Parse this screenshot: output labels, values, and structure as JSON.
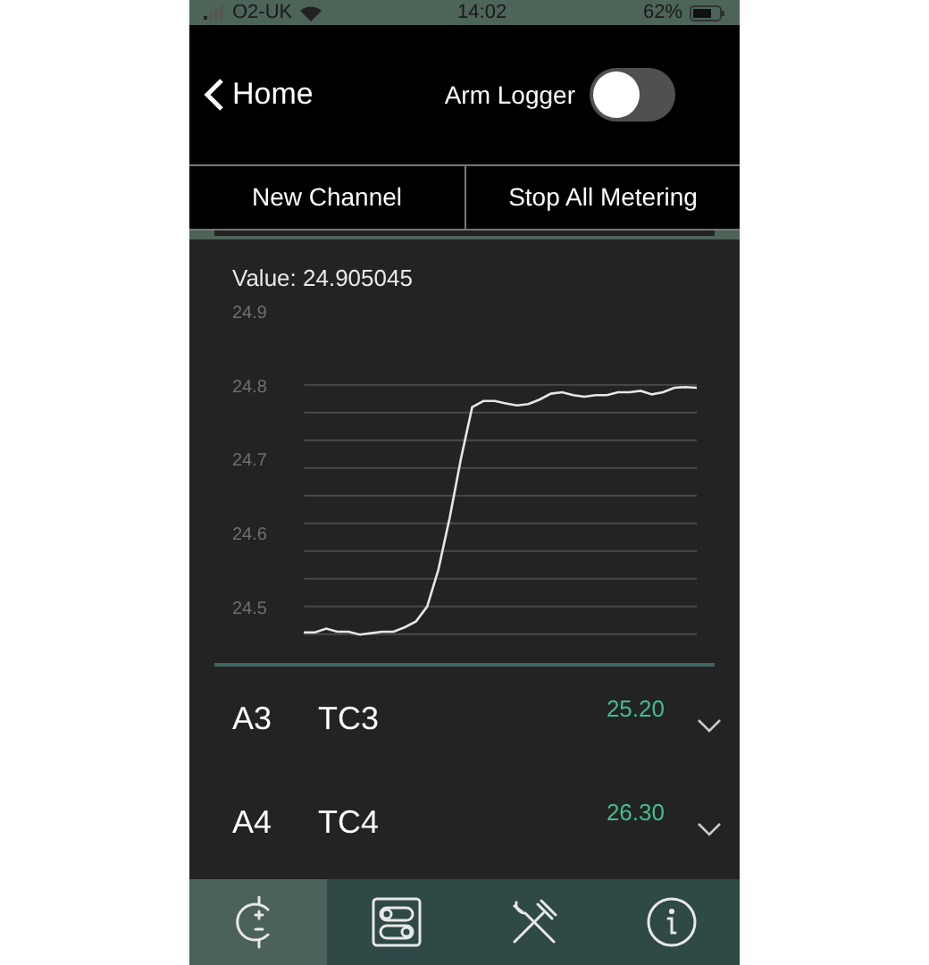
{
  "status_bar": {
    "carrier": "O2-UK",
    "time": "14:02",
    "battery": "62%"
  },
  "nav": {
    "back": "Home",
    "toggle_label": "Arm Logger",
    "toggle_on": false
  },
  "buttons": [
    "New Channel",
    "Stop All Metering"
  ],
  "chart": {
    "value_text": "Value: 24.905045",
    "chart_data": {
      "type": "line",
      "yticks": [
        24.5,
        24.6,
        24.7,
        24.8,
        24.9
      ],
      "ylim": [
        24.455,
        24.9
      ],
      "series": [
        {
          "color": "#e6e6e6",
          "values": [
            24.465,
            24.465,
            24.47,
            24.466,
            24.466,
            24.462,
            24.464,
            24.466,
            24.466,
            24.472,
            24.48,
            24.5,
            24.55,
            24.62,
            24.7,
            24.77,
            24.778,
            24.778,
            24.775,
            24.772,
            24.774,
            24.78,
            24.788,
            24.79,
            24.786,
            24.784,
            24.786,
            24.786,
            24.79,
            24.79,
            24.792,
            24.787,
            24.79,
            24.796,
            24.797,
            24.796
          ]
        }
      ]
    }
  },
  "channels": [
    {
      "id": "A3",
      "name": "TC3",
      "value": "25.20"
    },
    {
      "id": "A4",
      "name": "TC4",
      "value": "26.30"
    }
  ],
  "tabs": [
    {
      "kind": "meter",
      "selected": true
    },
    {
      "kind": "switches",
      "selected": false
    },
    {
      "kind": "tools",
      "selected": false
    },
    {
      "kind": "info",
      "selected": false
    }
  ]
}
